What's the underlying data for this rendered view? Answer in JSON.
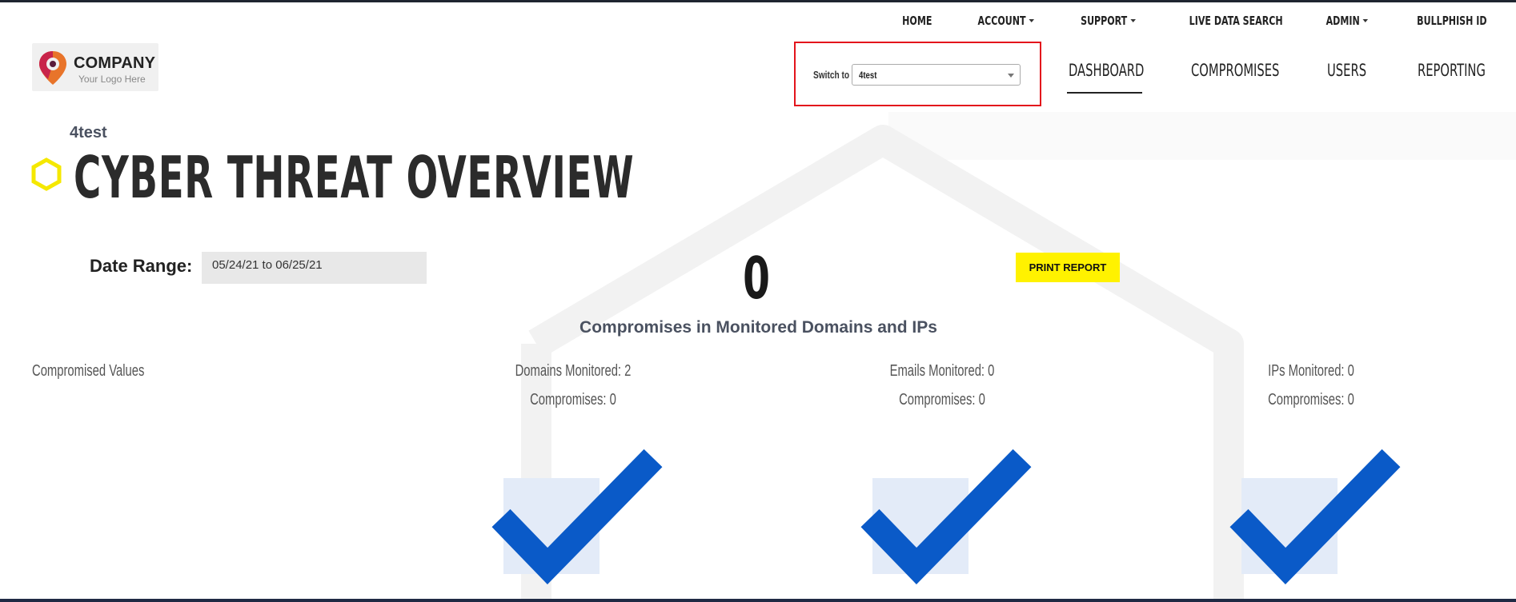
{
  "logo": {
    "name": "COMPANY",
    "tagline": "Your Logo Here"
  },
  "top_nav": [
    {
      "label": "HOME",
      "dropdown": false
    },
    {
      "label": "ACCOUNT",
      "dropdown": true
    },
    {
      "label": "SUPPORT",
      "dropdown": true
    },
    {
      "label": "LIVE DATA SEARCH",
      "dropdown": false
    },
    {
      "label": "ADMIN",
      "dropdown": true
    },
    {
      "label": "BULLPHISH ID",
      "dropdown": false
    }
  ],
  "switch": {
    "label": "Switch to",
    "selected": "4test"
  },
  "main_nav": {
    "dashboard": "DASHBOARD",
    "compromises": "COMPROMISES",
    "users": "USERS",
    "reporting": "REPORTING",
    "active": "dashboard"
  },
  "header": {
    "client": "4test",
    "title": "CYBER THREAT OVERVIEW"
  },
  "date_range": {
    "label": "Date Range:",
    "value": "05/24/21 to 06/25/21"
  },
  "summary": {
    "count": "0",
    "caption": "Compromises in Monitored Domains and IPs"
  },
  "print_button": "PRINT REPORT",
  "compromised_values": "Compromised Values",
  "stats": {
    "domains": {
      "monitored": "Domains Monitored: 2",
      "compromises": "Compromises: 0"
    },
    "emails": {
      "monitored": "Emails Monitored: 0",
      "compromises": "Compromises: 0"
    },
    "ips": {
      "monitored": "IPs Monitored: 0",
      "compromises": "Compromises: 0"
    }
  },
  "colors": {
    "accent_yellow": "#fff200",
    "check_blue": "#0a5ac8",
    "check_bg": "#e3ebf8",
    "highlight_red": "#e3141c"
  }
}
